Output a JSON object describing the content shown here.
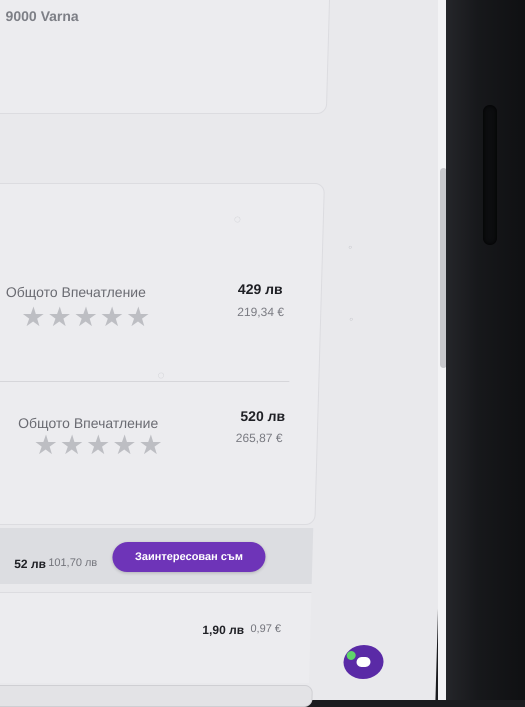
{
  "address": {
    "city": "9000 Varna"
  },
  "reviews": [
    {
      "label": "Общото Впечатление",
      "stars": 5,
      "price": "429 лв",
      "price_eur": "219,34 €"
    },
    {
      "label": "Общото Впечатление",
      "stars": 5,
      "price": "520 лв",
      "price_eur": "265,87 €"
    }
  ],
  "offer": {
    "price": "52 лв",
    "price_alt": "101,70 лв",
    "interest_button": "Заинтересован съм",
    "button_color": "#6e34b8"
  },
  "fee": {
    "price": "1,90 лв",
    "price_alt": "0,97 €"
  },
  "chat": {
    "icon": "chat-bubble-icon",
    "status_color": "#5fd36a"
  }
}
